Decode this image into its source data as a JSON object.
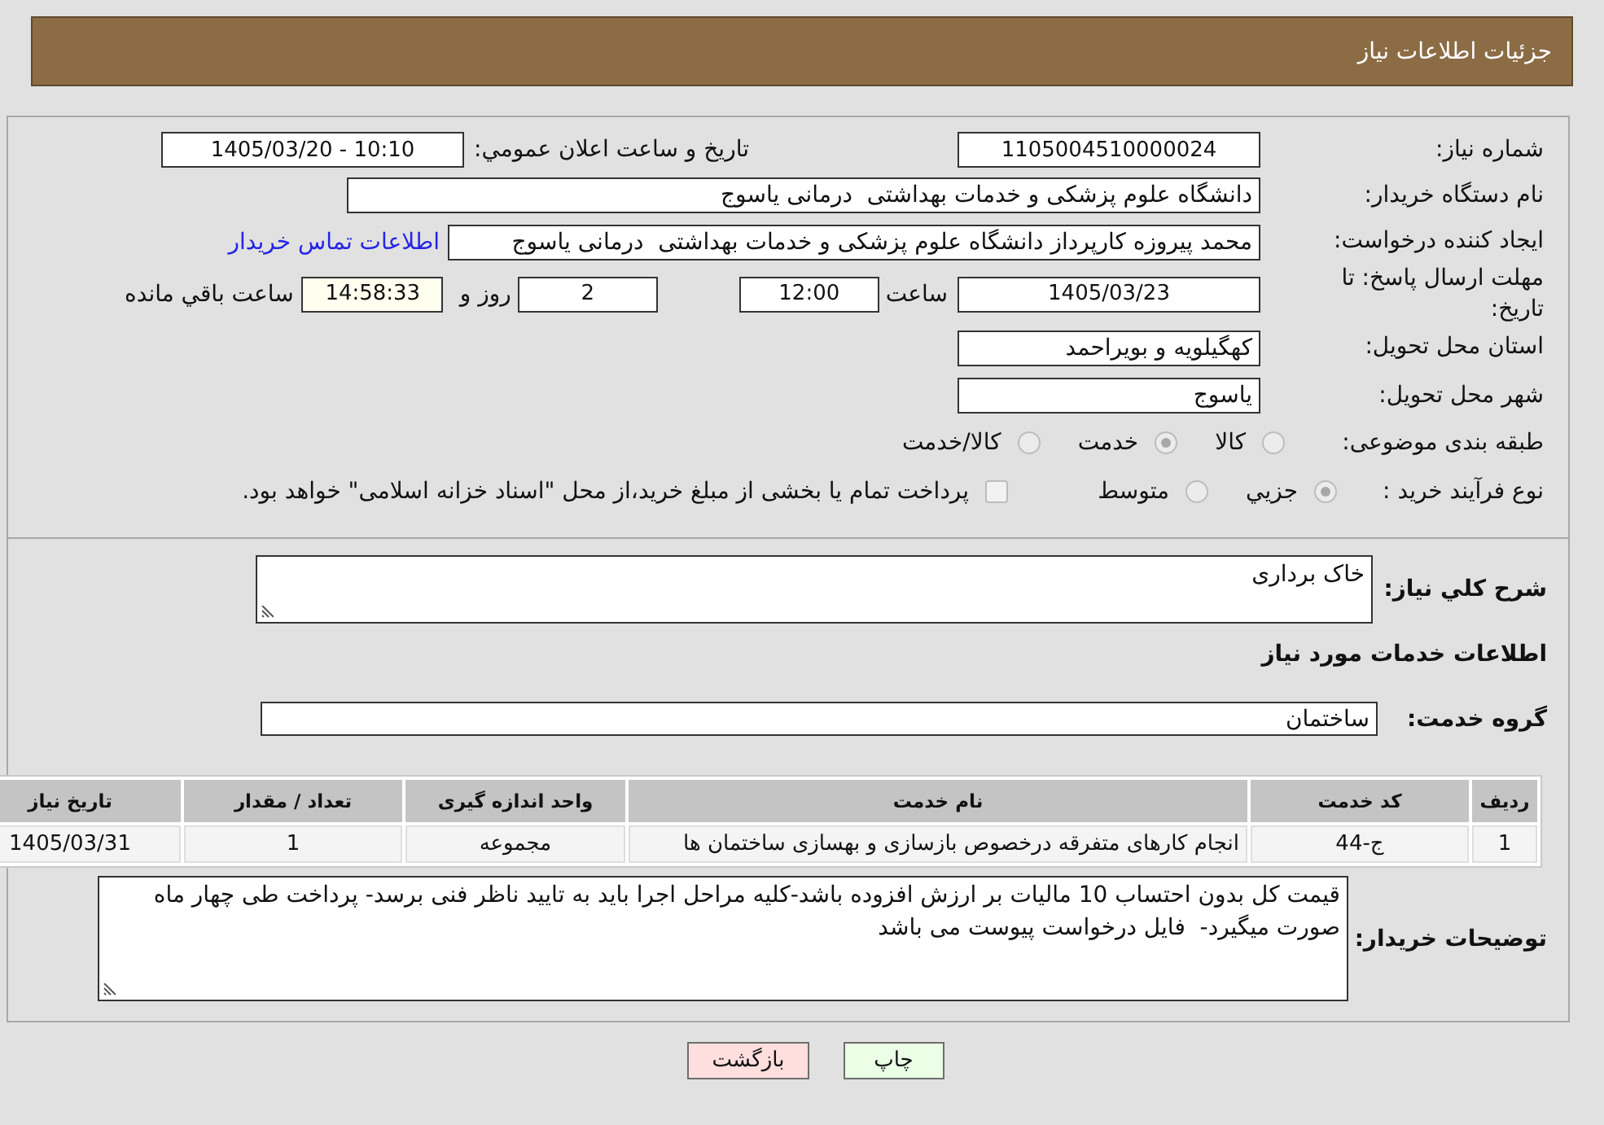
{
  "header": {
    "title": "جزئیات اطلاعات نیاز"
  },
  "details": {
    "need_number": {
      "label": "شماره نیاز:",
      "value": "1105004510000024"
    },
    "announcement": {
      "label": "تاریخ و ساعت اعلان عمومي:",
      "value": "1405/03/20 - 10:10"
    },
    "buyer_org": {
      "label": "نام دستگاه خریدار:",
      "value": "دانشگاه علوم پزشکی و خدمات بهداشتی  درمانی یاسوج"
    },
    "requester": {
      "label": "ایجاد کننده درخواست:",
      "value": "محمد پیروزه کارپرداز دانشگاه علوم پزشکی و خدمات بهداشتی  درمانی یاسوج",
      "link": "اطلاعات تماس خریدار"
    },
    "deadline": {
      "label": "مهلت ارسال پاسخ: تا تاریخ:",
      "date": "1405/03/23",
      "time_label": "ساعت",
      "time": "12:00",
      "days": "2",
      "days_label": "روز و",
      "remaining": "14:58:33",
      "remaining_label": "ساعت باقي مانده"
    },
    "province": {
      "label": "استان محل تحویل:",
      "value": "کهگیلویه و بویراحمد"
    },
    "city": {
      "label": "شهر محل تحویل:",
      "value": "یاسوج"
    },
    "category": {
      "label": "طبقه بندی موضوعی:",
      "options": [
        {
          "label": "کالا",
          "selected": false,
          "disabled": true
        },
        {
          "label": "خدمت",
          "selected": true,
          "disabled": true
        },
        {
          "label": "کالا/خدمت",
          "selected": false,
          "disabled": true
        }
      ]
    },
    "purchase_type": {
      "label": "نوع فرآیند خرید :",
      "options": [
        {
          "label": "جزيي",
          "selected": true,
          "disabled": true
        },
        {
          "label": "متوسط",
          "selected": false,
          "disabled": true
        }
      ],
      "treasury": {
        "label": "پرداخت تمام یا بخشی از مبلغ خرید،از محل \"اسناد خزانه اسلامی\" خواهد بود.",
        "checked": false,
        "disabled": true
      }
    }
  },
  "description": {
    "label": "شرح کلي نیاز:",
    "value": "خاک برداری"
  },
  "services": {
    "title": "اطلاعات خدمات مورد نیاز",
    "group": {
      "label": "گروه خدمت:",
      "value": "ساختمان"
    },
    "table": {
      "columns": [
        "ردیف",
        "کد خدمت",
        "نام خدمت",
        "واحد اندازه گیری",
        "تعداد / مقدار",
        "تاریخ نیاز"
      ],
      "rows": [
        [
          "1",
          "ج-44",
          "انجام کارهای متفرقه درخصوص بازسازی و بهسازی ساختمان ها",
          "مجموعه",
          "1",
          "1405/03/31"
        ]
      ]
    }
  },
  "buyer_notes": {
    "label": "توضیحات خریدار:",
    "value": "قیمت کل بدون احتساب 10 مالیات بر ارزش افزوده باشد-کلیه مراحل اجرا باید به تایید ناظر فنی برسد- پرداخت طی چهار ماه صورت میگیرد-  فایل درخواست پیوست می باشد"
  },
  "buttons": [
    {
      "label": "چاپ",
      "kind": "print"
    },
    {
      "label": "بازگشت",
      "kind": "back"
    }
  ]
}
